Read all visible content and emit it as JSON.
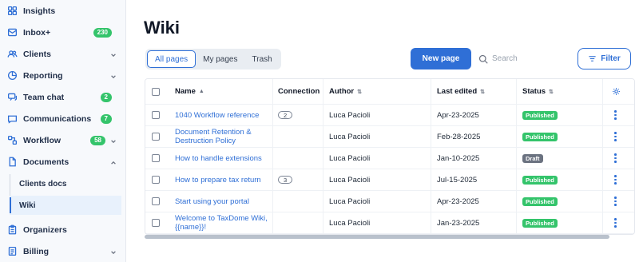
{
  "sidebar": {
    "items": [
      {
        "label": "Insights",
        "icon": "grid-icon",
        "badge": "",
        "chevron": false
      },
      {
        "label": "Inbox+",
        "icon": "inbox-icon",
        "badge": "230",
        "chevron": false
      },
      {
        "label": "Clients",
        "icon": "users-icon",
        "badge": "",
        "chevron": true
      },
      {
        "label": "Reporting",
        "icon": "pie-chart-icon",
        "badge": "",
        "chevron": true
      },
      {
        "label": "Team chat",
        "icon": "chat-icon",
        "badge": "2",
        "chevron": false
      },
      {
        "label": "Communications",
        "icon": "message-icon",
        "badge": "7",
        "chevron": false
      },
      {
        "label": "Workflow",
        "icon": "workflow-icon",
        "badge": "58",
        "chevron": true
      },
      {
        "label": "Documents",
        "icon": "document-icon",
        "badge": "",
        "chevron": true
      },
      {
        "label": "Organizers",
        "icon": "clipboard-icon",
        "badge": "",
        "chevron": false
      },
      {
        "label": "Billing",
        "icon": "billing-icon",
        "badge": "",
        "chevron": true
      }
    ],
    "sub_items": [
      {
        "label": "Clients docs",
        "active": false
      },
      {
        "label": "Wiki",
        "active": true
      }
    ]
  },
  "page": {
    "title": "Wiki"
  },
  "tabs": [
    {
      "label": "All pages",
      "active": true
    },
    {
      "label": "My pages",
      "active": false
    },
    {
      "label": "Trash",
      "active": false
    }
  ],
  "toolbar": {
    "new_page_label": "New page",
    "search_placeholder": "Search",
    "filter_label": "Filter"
  },
  "table": {
    "headers": {
      "name": "Name",
      "connection": "Connection",
      "author": "Author",
      "last_edited": "Last edited",
      "status": "Status"
    },
    "rows": [
      {
        "name": "1040 Workflow reference",
        "connection": "2",
        "author": "Luca Pacioli",
        "last_edited": "Apr-23-2025",
        "status": "Published"
      },
      {
        "name": "Document Retention & Destruction Policy",
        "connection": "",
        "author": "Luca Pacioli",
        "last_edited": "Feb-28-2025",
        "status": "Published"
      },
      {
        "name": "How to handle extensions",
        "connection": "",
        "author": "Luca Pacioli",
        "last_edited": "Jan-10-2025",
        "status": "Draft"
      },
      {
        "name": "How to prepare tax return",
        "connection": "3",
        "author": "Luca Pacioli",
        "last_edited": "Jul-15-2025",
        "status": "Published"
      },
      {
        "name": "Start using your portal",
        "connection": "",
        "author": "Luca Pacioli",
        "last_edited": "Apr-23-2025",
        "status": "Published"
      },
      {
        "name": "Welcome to TaxDome Wiki, {{name}}!",
        "connection": "",
        "author": "Luca Pacioli",
        "last_edited": "Jan-23-2025",
        "status": "Published"
      }
    ]
  },
  "colors": {
    "accent": "#2f6fd6",
    "published": "#34c46b",
    "draft": "#6b7280",
    "badge": "#34c46b"
  }
}
